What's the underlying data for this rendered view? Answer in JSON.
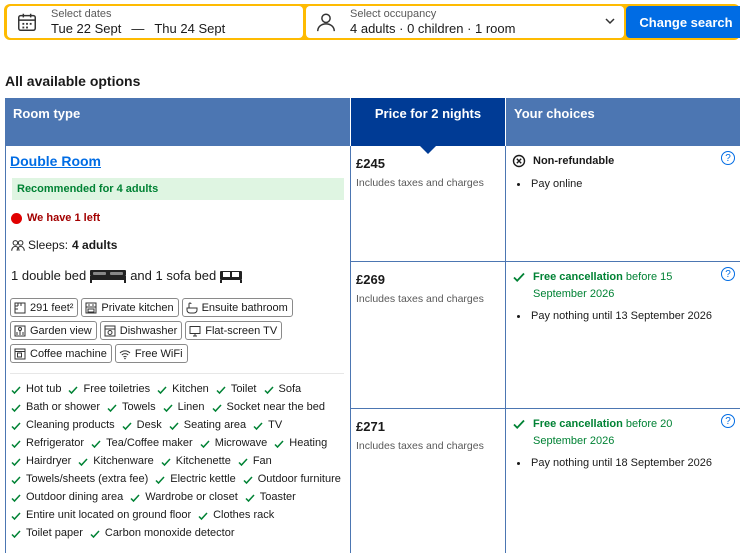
{
  "search": {
    "dates_label": "Select dates",
    "checkin": "Tue 22 Sept",
    "dash": "—",
    "checkout": "Thu 24 Sept",
    "occupancy_label": "Select occupancy",
    "occupancy_value": "4 adults · 0 children · 1 room",
    "button": "Change search"
  },
  "section_title": "All available options",
  "table": {
    "col_room": "Room type",
    "col_price": "Price for 2 nights",
    "col_choices": "Your choices"
  },
  "room": {
    "name": "Double Room",
    "recommended": "Recommended for 4 adults",
    "availability": "We have 1 left",
    "sleeps_label": "Sleeps:",
    "sleeps_value": "4 adults",
    "beds_part1": "1 double bed",
    "beds_part2": "and 1 sofa bed",
    "facilities": [
      {
        "icon": "ruler-icon",
        "label": "291 feet²"
      },
      {
        "icon": "kitchen-icon",
        "label": "Private kitchen"
      },
      {
        "icon": "bath-icon",
        "label": "Ensuite bathroom"
      },
      {
        "icon": "garden-icon",
        "label": "Garden view"
      },
      {
        "icon": "dishwasher-icon",
        "label": "Dishwasher"
      },
      {
        "icon": "tv-icon",
        "label": "Flat-screen TV"
      },
      {
        "icon": "coffee-icon",
        "label": "Coffee machine"
      },
      {
        "icon": "wifi-icon",
        "label": "Free WiFi"
      }
    ],
    "amenities": [
      "Hot tub",
      "Free toiletries",
      "Kitchen",
      "Toilet",
      "Sofa",
      "Bath or shower",
      "Towels",
      "Linen",
      "Socket near the bed",
      "Cleaning products",
      "Desk",
      "Seating area",
      "TV",
      "Refrigerator",
      "Tea/Coffee maker",
      "Microwave",
      "Heating",
      "Hairdryer",
      "Kitchenware",
      "Kitchenette",
      "Fan",
      "Towels/sheets (extra fee)",
      "Electric kettle",
      "Outdoor furniture",
      "Outdoor dining area",
      "Wardrobe or closet",
      "Toaster",
      "Entire unit located on ground floor",
      "Clothes rack",
      "Toilet paper",
      "Carbon monoxide detector"
    ]
  },
  "options": [
    {
      "price": "£245",
      "tax_note": "Includes taxes and charges",
      "policy_icon": "no-refund-icon",
      "policy_bold": "Non-refundable",
      "policy_rest": "",
      "bullet": "Pay online",
      "help": "?"
    },
    {
      "price": "£269",
      "tax_note": "Includes taxes and charges",
      "policy_icon": "check-icon",
      "policy_bold": "Free cancellation",
      "policy_rest": " before 15 September 2026",
      "bullet": "Pay nothing until 13 September 2026",
      "help": "?"
    },
    {
      "price": "£271",
      "tax_note": "Includes taxes and charges",
      "policy_icon": "check-icon",
      "policy_bold": "Free cancellation",
      "policy_rest": " before 20 September 2026",
      "bullet": "Pay nothing until 18 September 2026",
      "help": "?"
    }
  ],
  "colors": {
    "brand_yellow": "#febb02",
    "primary_blue": "#006ce4",
    "header_blue": "#4c76b2",
    "dark_blue": "#003b95",
    "green": "#008234",
    "red": "#e10000"
  }
}
